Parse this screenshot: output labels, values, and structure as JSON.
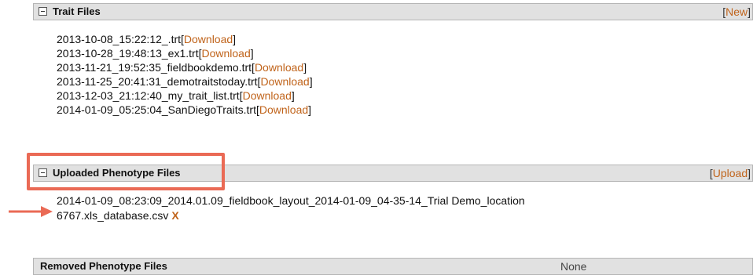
{
  "trait_files": {
    "title": "Trait Files",
    "action_label": "New",
    "items": [
      {
        "name": "2013-10-08_15:22:12_.trt",
        "link": "Download"
      },
      {
        "name": "2013-10-28_19:48:13_ex1.trt",
        "link": "Download"
      },
      {
        "name": "2013-11-21_19:52:35_fieldbookdemo.trt",
        "link": "Download"
      },
      {
        "name": "2013-11-25_20:41:31_demotraitstoday.trt",
        "link": "Download"
      },
      {
        "name": "2013-12-03_21:12:40_my_trait_list.trt",
        "link": "Download"
      },
      {
        "name": "2014-01-09_05:25:04_SanDiegoTraits.trt",
        "link": "Download"
      }
    ]
  },
  "uploaded_phenotype_files": {
    "title": "Uploaded Phenotype Files",
    "action_label": "Upload",
    "items": [
      {
        "name_line1": "2014-01-09_08:23:09_2014.01.09_fieldbook_layout_2014-01-09_04-35-14_Trial Demo_location",
        "name_line2": "6767.xls_database.csv",
        "delete_label": "X"
      }
    ]
  },
  "removed_phenotype_files": {
    "title": "Removed Phenotype Files",
    "value": "None"
  },
  "colors": {
    "link": "#c0631a",
    "header_bg": "#e1e1e1",
    "highlight": "#ea6a55"
  }
}
